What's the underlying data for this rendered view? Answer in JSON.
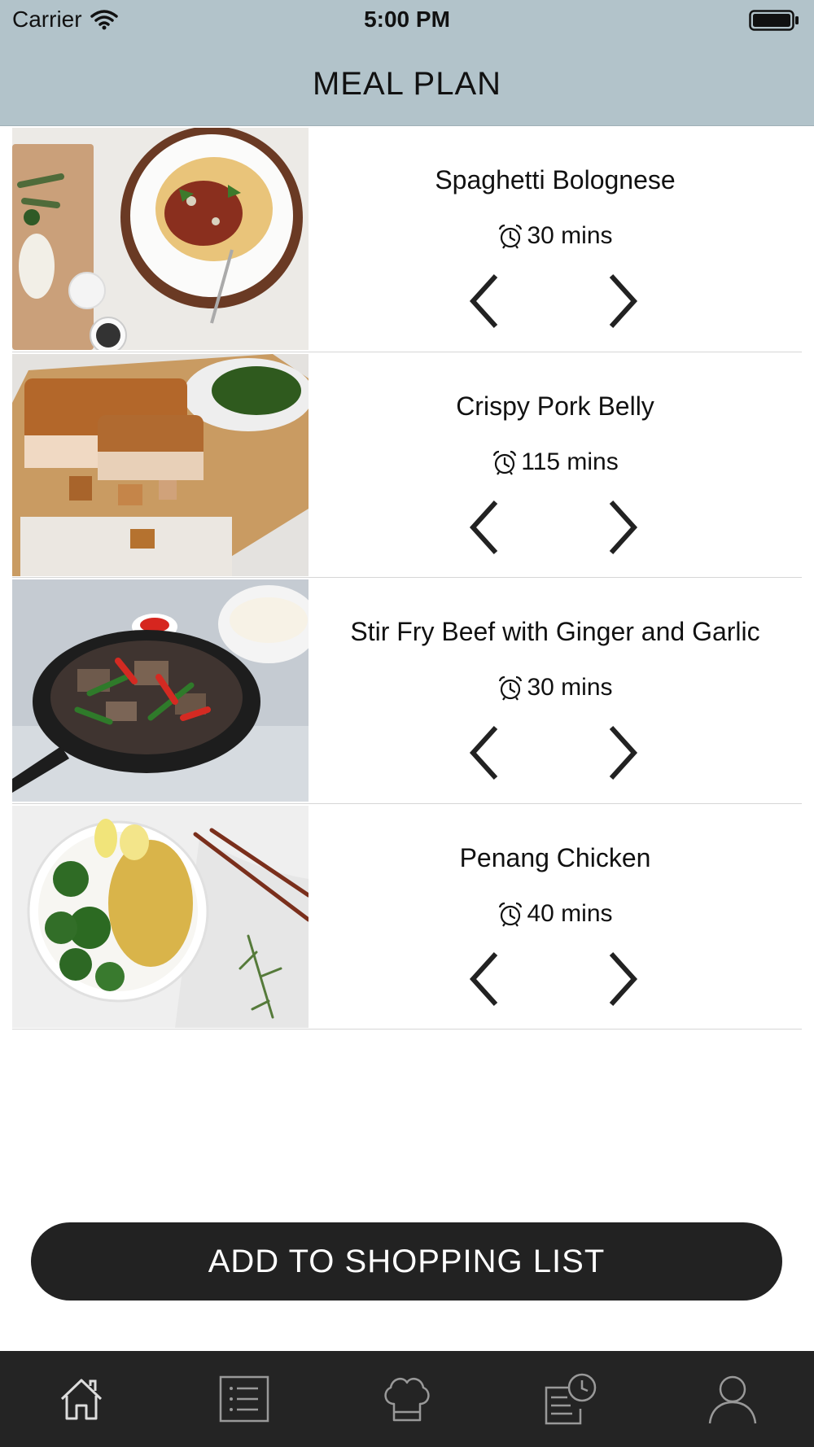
{
  "status_bar": {
    "carrier": "Carrier",
    "time": "5:00 PM"
  },
  "header": {
    "title": "MEAL PLAN"
  },
  "meals": [
    {
      "name": "Spaghetti Bolognese",
      "time": "30 mins"
    },
    {
      "name": "Crispy Pork Belly",
      "time": "115 mins"
    },
    {
      "name": "Stir Fry Beef with Ginger and Garlic",
      "time": "30 mins"
    },
    {
      "name": "Penang Chicken",
      "time": "40 mins"
    }
  ],
  "actions": {
    "add_to_shopping_list": "ADD TO SHOPPING LIST"
  },
  "tab_bar": {
    "items": [
      {
        "icon": "home-icon"
      },
      {
        "icon": "list-icon"
      },
      {
        "icon": "chef-hat-icon"
      },
      {
        "icon": "history-icon"
      },
      {
        "icon": "profile-icon"
      }
    ]
  },
  "colors": {
    "header_bg": "#b2c3ca",
    "button_bg": "#222222",
    "tabbar_bg": "#242424"
  }
}
